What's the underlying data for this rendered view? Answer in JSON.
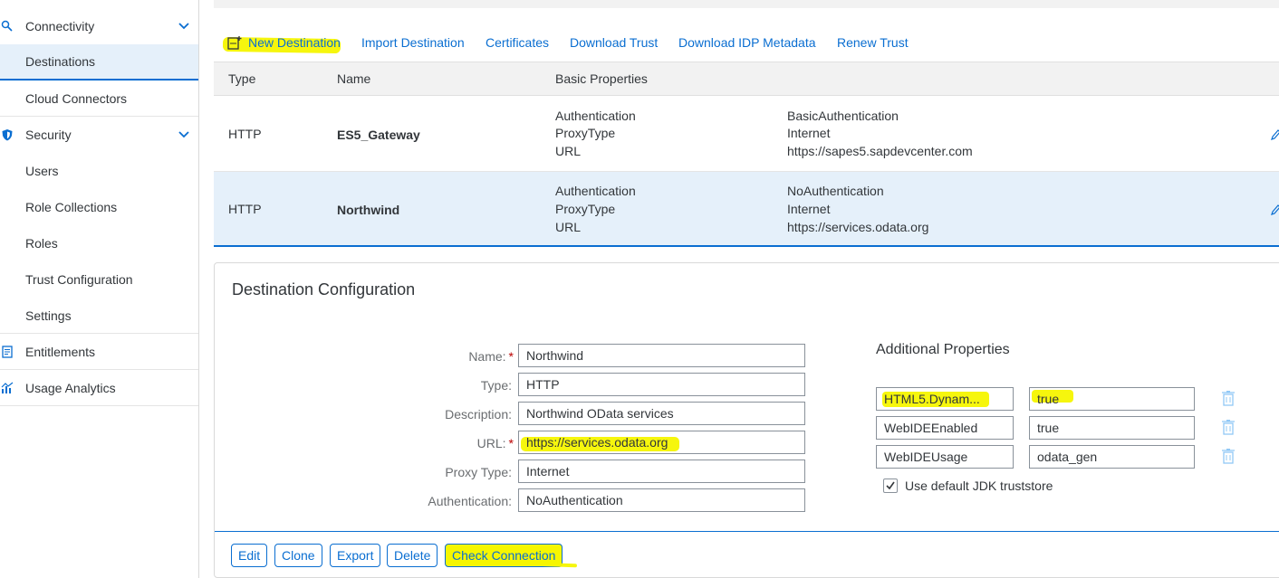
{
  "sidebar": {
    "items": [
      {
        "label": "Connectivity",
        "icon": "connectivity-icon",
        "expandable": true
      },
      {
        "label": "Destinations",
        "selected": true
      },
      {
        "label": "Cloud Connectors"
      },
      {
        "label": "Security",
        "icon": "shield-icon",
        "expandable": true
      },
      {
        "label": "Users"
      },
      {
        "label": "Role Collections"
      },
      {
        "label": "Roles"
      },
      {
        "label": "Trust Configuration"
      },
      {
        "label": "Settings"
      },
      {
        "label": "Entitlements",
        "icon": "entitlements-icon"
      },
      {
        "label": "Usage Analytics",
        "icon": "analytics-icon"
      }
    ]
  },
  "toolbar": {
    "new_destination": "New Destination",
    "import_destination": "Import Destination",
    "certificates": "Certificates",
    "download_trust": "Download Trust",
    "download_idp_metadata": "Download IDP Metadata",
    "renew_trust": "Renew Trust"
  },
  "table": {
    "headers": [
      "Type",
      "Name",
      "Basic Properties"
    ],
    "rows": [
      {
        "type": "HTTP",
        "name": "ES5_Gateway",
        "prop_keys": [
          "Authentication",
          "ProxyType",
          "URL"
        ],
        "prop_values": [
          "BasicAuthentication",
          "Internet",
          "https://sapes5.sapdevcenter.com"
        ]
      },
      {
        "type": "HTTP",
        "name": "Northwind",
        "selected": true,
        "prop_keys": [
          "Authentication",
          "ProxyType",
          "URL"
        ],
        "prop_values": [
          "NoAuthentication",
          "Internet",
          "https://services.odata.org"
        ]
      }
    ]
  },
  "config": {
    "title": "Destination Configuration",
    "fields": [
      {
        "label": "Name:",
        "value": "Northwind",
        "required": "*"
      },
      {
        "label": "Type:",
        "value": "HTTP"
      },
      {
        "label": "Description:",
        "value": "Northwind OData services"
      },
      {
        "label": "URL:",
        "value": "https://services.odata.org",
        "required": "*"
      },
      {
        "label": "Proxy Type:",
        "value": "Internet"
      },
      {
        "label": "Authentication:",
        "value": "NoAuthentication"
      }
    ],
    "additional_title": "Additional Properties",
    "additional": [
      {
        "key": "HTML5.Dynam...",
        "value": "true"
      },
      {
        "key": "WebIDEEnabled",
        "value": "true"
      },
      {
        "key": "WebIDEUsage",
        "value": "odata_gen"
      }
    ],
    "truststore_label": "Use default JDK truststore",
    "truststore_checked": true,
    "buttons": {
      "edit": "Edit",
      "clone": "Clone",
      "export": "Export",
      "delete": "Delete",
      "check_connection": "Check Connection"
    }
  },
  "colors": {
    "accent": "#0a6ed1",
    "selected_row": "#e5f0fa",
    "highlight": "#f6f600",
    "required": "#bb0000"
  }
}
